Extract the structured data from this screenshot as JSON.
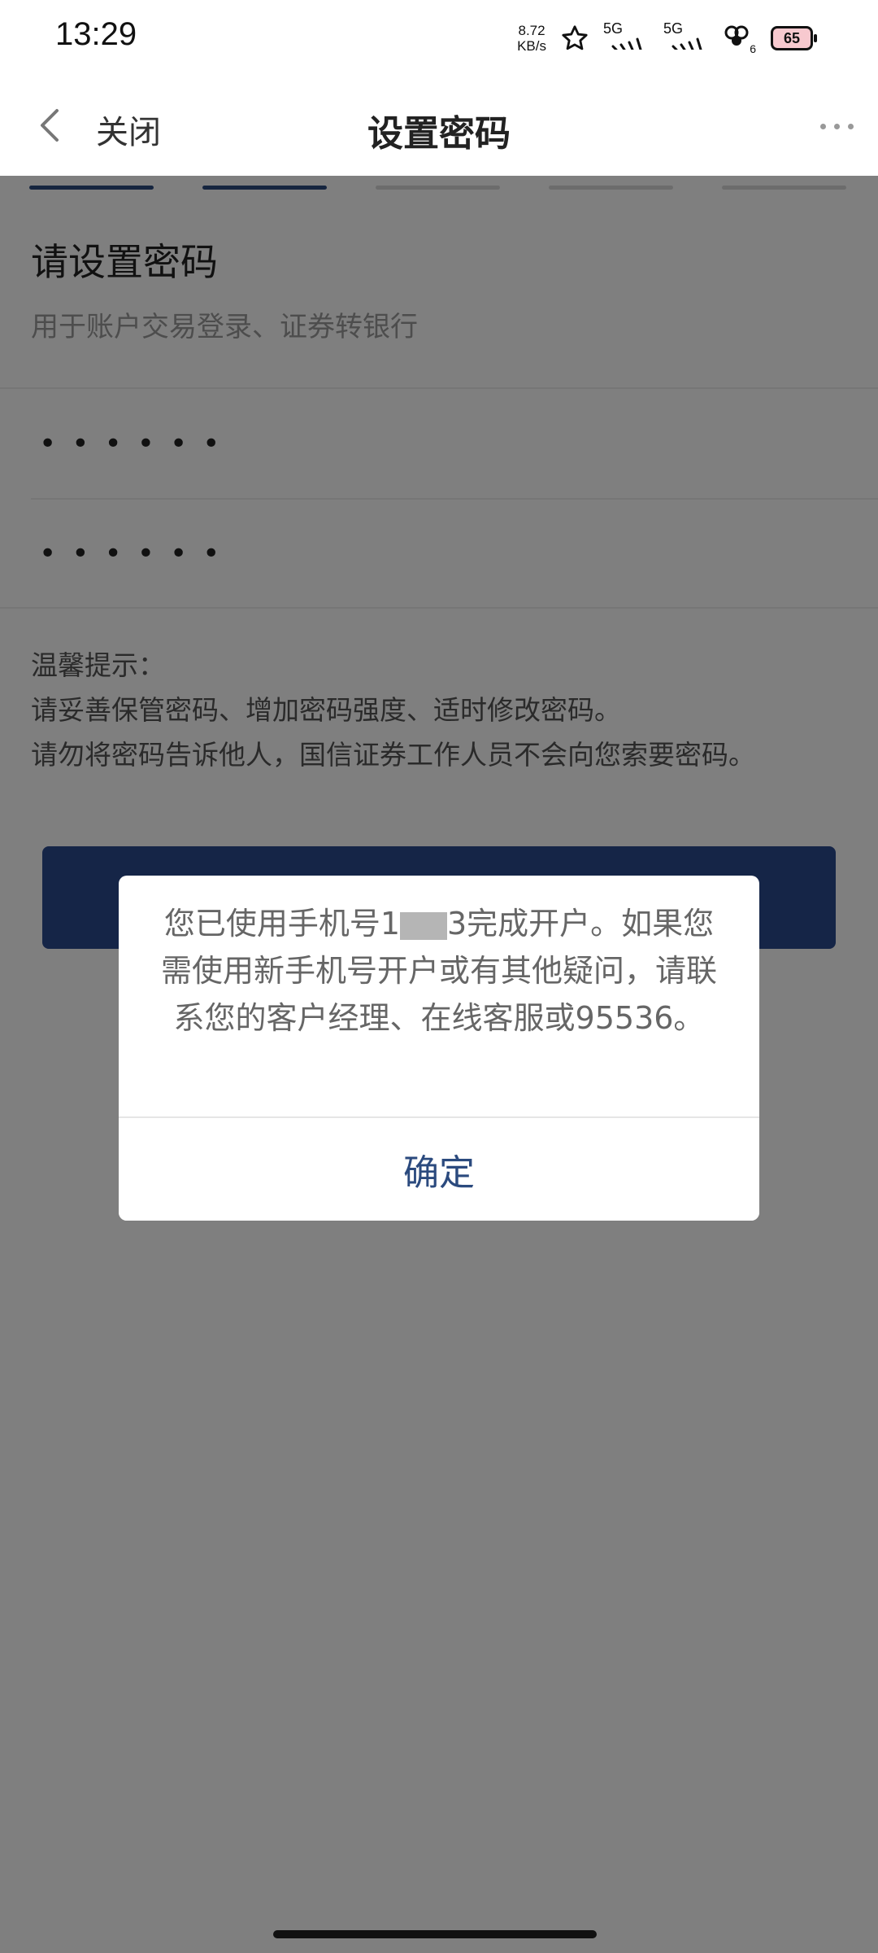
{
  "status_bar": {
    "time": "13:29",
    "net_speed_value": "8.72",
    "net_speed_unit": "KB/s",
    "signal_1": "5G",
    "signal_2": "5G",
    "battery": "65",
    "wifi_sub": "6"
  },
  "nav": {
    "close_label": "关闭",
    "title": "设置密码"
  },
  "steps": {
    "total": 5,
    "active": 2
  },
  "form": {
    "title": "请设置密码",
    "subtitle": "用于账户交易登录、证券转银行",
    "password_mask": "••••••",
    "confirm_password_mask": "••••••"
  },
  "tips": {
    "heading": "温馨提示：",
    "line1": "请妥善保管密码、增加密码强度、适时修改密码。",
    "line2": "请勿将密码告诉他人，国信证券工作人员不会向您索要密码。"
  },
  "dialog": {
    "message_prefix": "您已使用手机号1",
    "message_suffix": "3完成开户。如果您需使用新手机号开户或有其他疑问，请联系您的客户经理、在线客服或95536。",
    "confirm_label": "确定"
  }
}
